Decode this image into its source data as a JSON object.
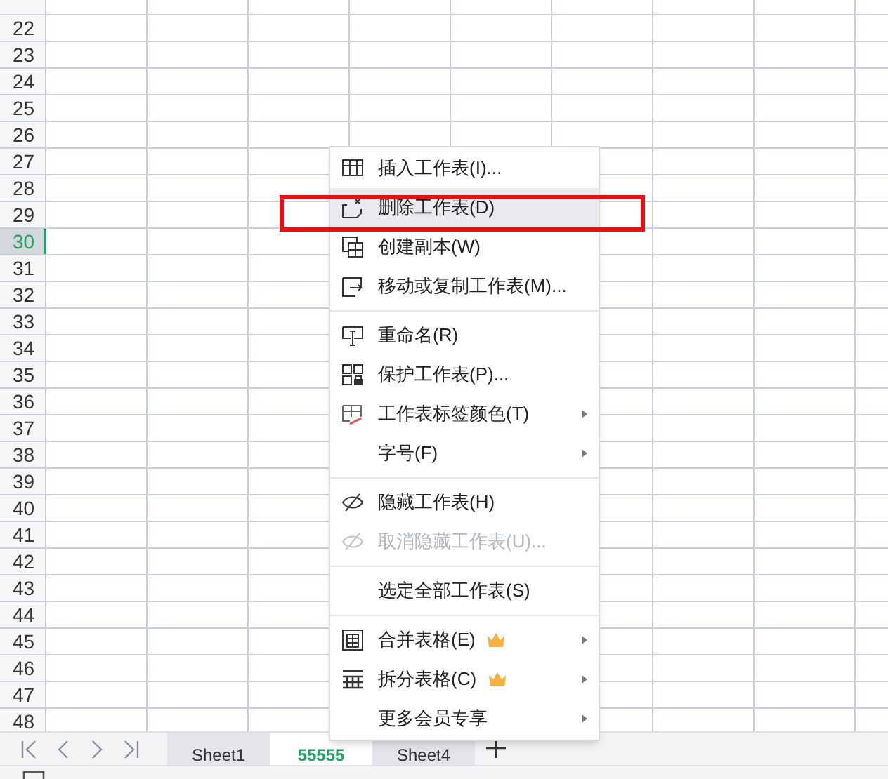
{
  "rows": [
    {
      "label": "22",
      "selected": false
    },
    {
      "label": "23",
      "selected": false
    },
    {
      "label": "24",
      "selected": false
    },
    {
      "label": "25",
      "selected": false
    },
    {
      "label": "26",
      "selected": false
    },
    {
      "label": "27",
      "selected": false
    },
    {
      "label": "28",
      "selected": false
    },
    {
      "label": "29",
      "selected": false
    },
    {
      "label": "30",
      "selected": true
    },
    {
      "label": "31",
      "selected": false
    },
    {
      "label": "32",
      "selected": false
    },
    {
      "label": "33",
      "selected": false
    },
    {
      "label": "34",
      "selected": false
    },
    {
      "label": "35",
      "selected": false
    },
    {
      "label": "36",
      "selected": false
    },
    {
      "label": "37",
      "selected": false
    },
    {
      "label": "38",
      "selected": false
    },
    {
      "label": "39",
      "selected": false
    },
    {
      "label": "40",
      "selected": false
    },
    {
      "label": "41",
      "selected": false
    },
    {
      "label": "42",
      "selected": false
    },
    {
      "label": "43",
      "selected": false
    },
    {
      "label": "44",
      "selected": false
    },
    {
      "label": "45",
      "selected": false
    },
    {
      "label": "46",
      "selected": false
    },
    {
      "label": "47",
      "selected": false
    },
    {
      "label": "48",
      "selected": false
    }
  ],
  "context_menu": {
    "items": [
      {
        "kind": "item",
        "label": "插入工作表(I)...",
        "highlighted": false,
        "disabled": false,
        "submenu": false,
        "premium": false
      },
      {
        "kind": "item",
        "label": "删除工作表(D)",
        "highlighted": true,
        "disabled": false,
        "submenu": false,
        "premium": false
      },
      {
        "kind": "item",
        "label": "创建副本(W)",
        "highlighted": false,
        "disabled": false,
        "submenu": false,
        "premium": false
      },
      {
        "kind": "item",
        "label": "移动或复制工作表(M)...",
        "highlighted": false,
        "disabled": false,
        "submenu": false,
        "premium": false
      },
      {
        "kind": "separator"
      },
      {
        "kind": "item",
        "label": "重命名(R)",
        "highlighted": false,
        "disabled": false,
        "submenu": false,
        "premium": false
      },
      {
        "kind": "item",
        "label": "保护工作表(P)...",
        "highlighted": false,
        "disabled": false,
        "submenu": false,
        "premium": false
      },
      {
        "kind": "item",
        "label": "工作表标签颜色(T)",
        "highlighted": false,
        "disabled": false,
        "submenu": true,
        "premium": false
      },
      {
        "kind": "item",
        "label": "字号(F)",
        "highlighted": false,
        "disabled": false,
        "submenu": true,
        "premium": false
      },
      {
        "kind": "separator"
      },
      {
        "kind": "item",
        "label": "隐藏工作表(H)",
        "highlighted": false,
        "disabled": false,
        "submenu": false,
        "premium": false
      },
      {
        "kind": "item",
        "label": "取消隐藏工作表(U)...",
        "highlighted": false,
        "disabled": true,
        "submenu": false,
        "premium": false
      },
      {
        "kind": "separator"
      },
      {
        "kind": "item",
        "label": "选定全部工作表(S)",
        "highlighted": false,
        "disabled": false,
        "submenu": false,
        "premium": false
      },
      {
        "kind": "separator"
      },
      {
        "kind": "item",
        "label": "合并表格(E)",
        "highlighted": false,
        "disabled": false,
        "submenu": true,
        "premium": true
      },
      {
        "kind": "item",
        "label": "拆分表格(C)",
        "highlighted": false,
        "disabled": false,
        "submenu": true,
        "premium": true
      },
      {
        "kind": "item",
        "label": "更多会员专享",
        "highlighted": false,
        "disabled": false,
        "submenu": true,
        "premium": false
      }
    ]
  },
  "sheet_tabs": [
    {
      "label": "Sheet1",
      "selected": false
    },
    {
      "label": "55555",
      "selected": true
    },
    {
      "label": "Sheet4",
      "selected": false
    }
  ]
}
